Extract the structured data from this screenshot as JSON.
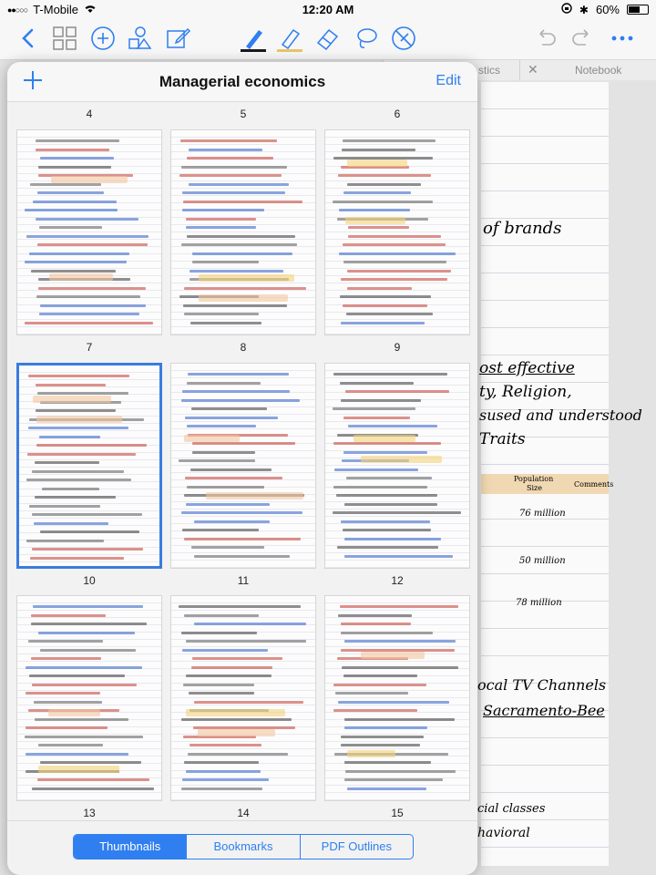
{
  "status": {
    "carrier": "T-Mobile",
    "time": "12:20 AM",
    "battery": "60%",
    "battery_level": 0.6
  },
  "toolbar": {
    "icons": [
      "back-chevron-icon",
      "grid-icon",
      "add-circle-icon",
      "shapes-icon",
      "edit-icon",
      "pen-icon",
      "highlighter-icon",
      "eraser-icon",
      "lasso-icon",
      "no-select-icon",
      "undo-icon",
      "redo-icon",
      "more-icon"
    ],
    "pen_color": "#1a1a1a",
    "highlighter_color": "#e9c46a",
    "accent": "#2f7ff0"
  },
  "background": {
    "tab1": "stics",
    "tab2": "Notebook",
    "lines": [
      {
        "text": "of brands",
        "color": "#444"
      },
      {
        "text": "ost effective",
        "color": "#d43a2a"
      },
      {
        "text": "ty, Religion,",
        "color": "#333"
      },
      {
        "text": "sused and understood",
        "color": "#d43a2a"
      },
      {
        "text": "Traits",
        "color": "#d43a2a"
      },
      {
        "text": "Population",
        "color": "#555"
      },
      {
        "text": "Size",
        "color": "#555"
      },
      {
        "text": "Comments",
        "color": "#555"
      },
      {
        "text": "76 million",
        "color": "#2a5bc4"
      },
      {
        "text": "50 million",
        "color": "#2a5bc4"
      },
      {
        "text": "78 million",
        "color": "#d43a2a"
      },
      {
        "text": "ocal TV Channels",
        "color": "#2a5bc4"
      },
      {
        "text": "Sacramento-Bee",
        "color": "#2a5bc4"
      },
      {
        "text": "cial classes",
        "color": "#555"
      },
      {
        "text": "havioral",
        "color": "#555"
      }
    ]
  },
  "popover": {
    "title": "Managerial economics",
    "edit_label": "Edit",
    "top_page_numbers": [
      "4",
      "5",
      "6"
    ],
    "pages": [
      {
        "number": "7",
        "selected": false
      },
      {
        "number": "8",
        "selected": false
      },
      {
        "number": "9",
        "selected": false
      },
      {
        "number": "10",
        "selected": true
      },
      {
        "number": "11",
        "selected": false
      },
      {
        "number": "12",
        "selected": false
      },
      {
        "number": "13",
        "selected": false
      },
      {
        "number": "14",
        "selected": false
      },
      {
        "number": "15",
        "selected": false
      }
    ],
    "tabs": [
      {
        "label": "Thumbnails",
        "active": true
      },
      {
        "label": "Bookmarks",
        "active": false
      },
      {
        "label": "PDF Outlines",
        "active": false
      }
    ]
  }
}
